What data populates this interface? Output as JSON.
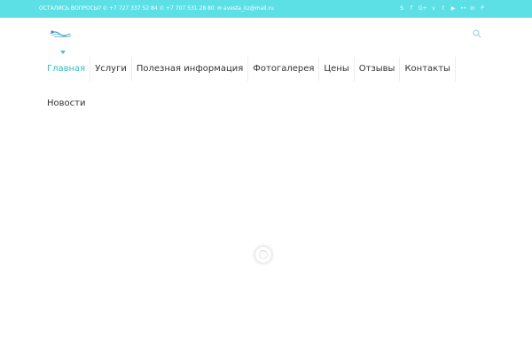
{
  "topbar": {
    "bg_color": "#5ddfe6",
    "question": "ОСТАЛИСЬ ВОПРОСЫ?",
    "phone1": "+7 727 337 52 84",
    "phone2": "+7 707 531 28 80",
    "email": "avesta_kz@mail.ru",
    "socials": [
      "skype-icon",
      "facebook-icon",
      "google-plus-icon",
      "vimeo-icon",
      "twitter-icon",
      "youtube-icon",
      "flickr-icon",
      "linkedin-icon",
      "pinterest-icon"
    ]
  },
  "header": {
    "logo": "logo",
    "search_icon": "search-icon"
  },
  "nav": {
    "items": [
      {
        "label": "Главная",
        "active": true
      },
      {
        "label": "Услуги"
      },
      {
        "label": "Полезная информация"
      },
      {
        "label": "Фотогалерея"
      },
      {
        "label": "Цены"
      },
      {
        "label": "Отзывы"
      },
      {
        "label": "Контакты"
      },
      {
        "label": "Новости"
      }
    ],
    "accent_color": "#37bcc4"
  }
}
